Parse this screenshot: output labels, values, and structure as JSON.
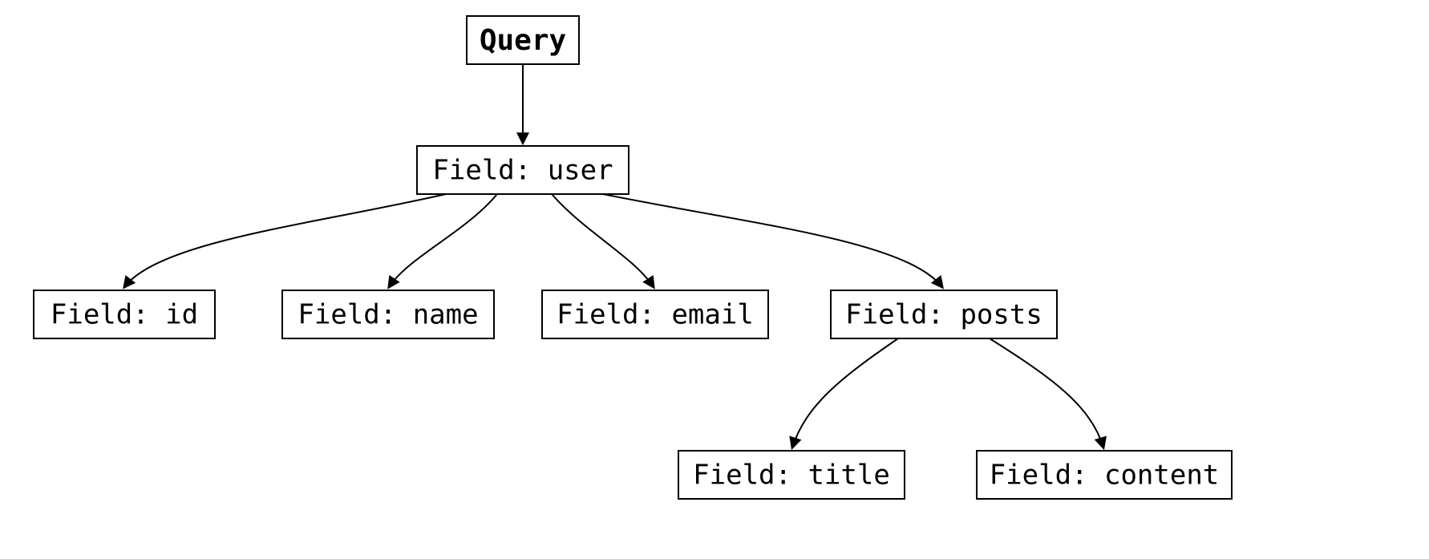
{
  "diagram": {
    "root": {
      "label": "Query"
    },
    "level1": {
      "user": {
        "label": "Field: user"
      }
    },
    "level2": {
      "id": {
        "label": "Field: id"
      },
      "name": {
        "label": "Field: name"
      },
      "email": {
        "label": "Field: email"
      },
      "posts": {
        "label": "Field: posts"
      }
    },
    "level3": {
      "title": {
        "label": "Field: title"
      },
      "content": {
        "label": "Field: content"
      }
    }
  }
}
